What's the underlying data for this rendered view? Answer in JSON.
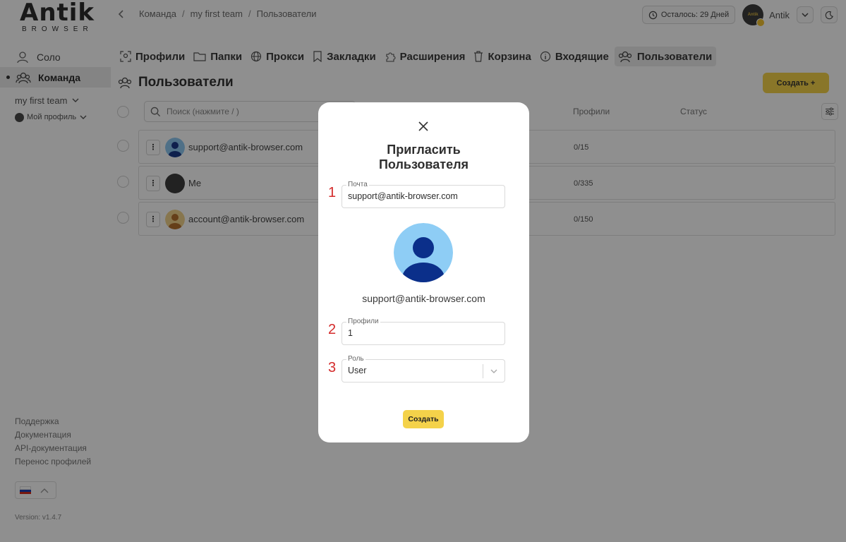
{
  "logo": {
    "main": "Antik",
    "sub": "BROWSER"
  },
  "breadcrumb": [
    "Команда",
    "my first team",
    "Пользователи"
  ],
  "header": {
    "days_left": "Осталось: 29 Дней",
    "user_name": "Antik",
    "avatar_text": "Antik"
  },
  "sidebar": {
    "items": [
      {
        "label": "Соло",
        "icon": "user-icon",
        "active": false
      },
      {
        "label": "Команда",
        "icon": "team-icon",
        "active": true
      }
    ],
    "team_select": "my first team",
    "profile_select": "Мой профиль",
    "links": [
      "Поддержка",
      "Документация",
      "API-документация",
      "Перенос профилей"
    ],
    "language": "ru",
    "version": "Version: v1.4.7"
  },
  "tabs": [
    {
      "label": "Профили",
      "icon": "profiles-icon"
    },
    {
      "label": "Папки",
      "icon": "folder-icon"
    },
    {
      "label": "Прокси",
      "icon": "globe-icon"
    },
    {
      "label": "Закладки",
      "icon": "bookmark-icon"
    },
    {
      "label": "Расширения",
      "icon": "puzzle-icon"
    },
    {
      "label": "Корзина",
      "icon": "trash-icon"
    },
    {
      "label": "Входящие",
      "icon": "info-icon"
    },
    {
      "label": "Пользователи",
      "icon": "users-icon",
      "active": true
    }
  ],
  "page": {
    "title": "Пользователи",
    "create_button": "Создать +",
    "search_placeholder": "Поиск (нажмите / )",
    "columns": {
      "profiles": "Профили",
      "status": "Статус"
    }
  },
  "users": [
    {
      "email": "support@antik-browser.com",
      "profiles": "0/15",
      "avatar": "blue"
    },
    {
      "email": "Me",
      "profiles": "0/335",
      "avatar": "dark"
    },
    {
      "email": "account@antik-browser.com",
      "profiles": "0/150",
      "avatar": "tan"
    }
  ],
  "modal": {
    "title_line1": "Пригласить",
    "title_line2": "Пользователя",
    "email_label": "Почта",
    "email_value": "support@antik-browser.com",
    "preview_email": "support@antik-browser.com",
    "profiles_label": "Профили",
    "profiles_value": "1",
    "role_label": "Роль",
    "role_value": "User",
    "submit": "Создать",
    "markers": [
      "1",
      "2",
      "3"
    ]
  },
  "colors": {
    "accent": "#f4d24a",
    "marker": "#d42a2a",
    "overlay": "rgba(0,0,0,0.44)"
  }
}
